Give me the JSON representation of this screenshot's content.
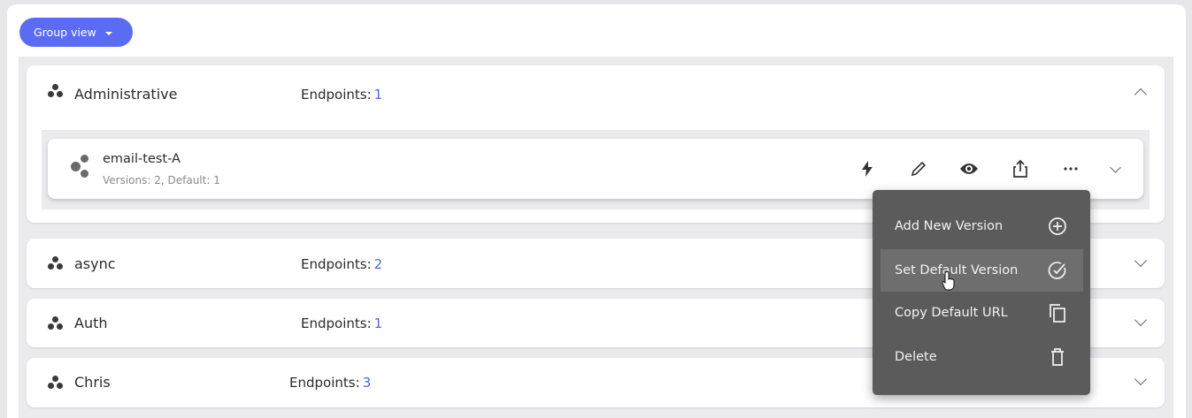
{
  "toolbar": {
    "group_view_label": "Group view"
  },
  "groups": [
    {
      "name": "Administrative",
      "endpoints_label": "Endpoints:",
      "endpoints_count": "1",
      "expanded": true
    },
    {
      "name": "async",
      "endpoints_label": "Endpoints:",
      "endpoints_count": "2",
      "expanded": false
    },
    {
      "name": "Auth",
      "endpoints_label": "Endpoints:",
      "endpoints_count": "1",
      "expanded": false
    },
    {
      "name": "Chris",
      "endpoints_label": "Endpoints:",
      "endpoints_count": "3",
      "expanded": false
    }
  ],
  "endpoint": {
    "name": "email-test-A",
    "meta": "Versions: 2, Default: 1",
    "actions": [
      "lightning-icon",
      "edit-icon",
      "view-icon",
      "share-icon",
      "more-icon",
      "chevron-down-icon"
    ]
  },
  "context_menu": {
    "items": [
      {
        "label": "Add New Version",
        "icon": "add-circle-icon"
      },
      {
        "label": "Set Default Version",
        "icon": "check-circle-icon",
        "hovered": true
      },
      {
        "label": "Copy Default URL",
        "icon": "copy-icon"
      },
      {
        "label": "Delete",
        "icon": "trash-icon"
      }
    ]
  },
  "colors": {
    "accent": "#5b6cf4",
    "count": "#4f66e0",
    "menu_bg": "#5b5b5b",
    "menu_hover": "#6e6e6e"
  }
}
